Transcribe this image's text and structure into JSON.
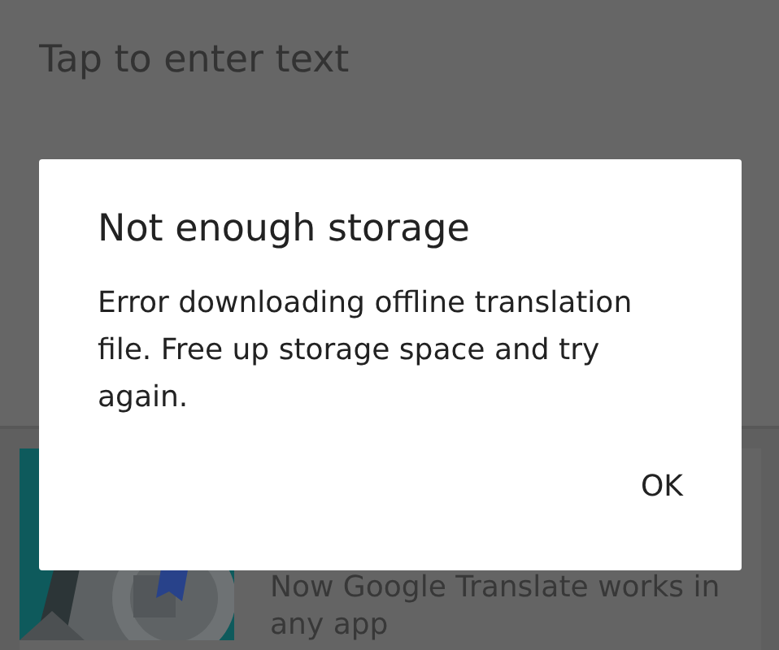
{
  "input": {
    "placeholder": "Tap to enter text"
  },
  "card": {
    "kind": "picture",
    "text": "Now Google Translate works in any app"
  },
  "dialog": {
    "title": "Not enough storage",
    "message": "Error downloading offline translation file. Free up storage space and try again.",
    "buttons": [
      "OK"
    ]
  }
}
